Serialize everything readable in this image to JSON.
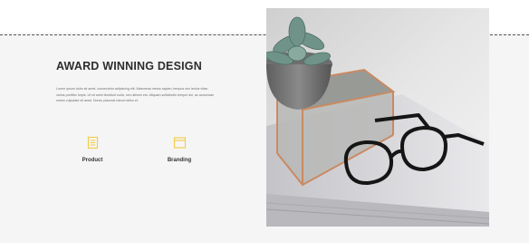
{
  "section": {
    "title": "AWARD WINNING DESIGN",
    "paragraph": "Lorem ipsum dolor sit amet, consectetur adipiscing elit. Maecenas metus sapien, tempus nec lectus vitae, varius porttitor turpis. Ut sit amet tincidunt nulla, nec ultrices est. Aliquam sollicitudin tempor dui, ac accumsan metus vulputate sit amet. Donec placerat rutrum tellus et."
  },
  "features": [
    {
      "label": "Product",
      "icon": "document-icon"
    },
    {
      "label": "Branding",
      "icon": "browser-window-icon"
    }
  ],
  "colors": {
    "accent": "#f2cd4f",
    "heading": "#2d2d2d",
    "band": "#f5f5f5"
  },
  "photo": {
    "subject": "succulent-glasses-photo"
  }
}
